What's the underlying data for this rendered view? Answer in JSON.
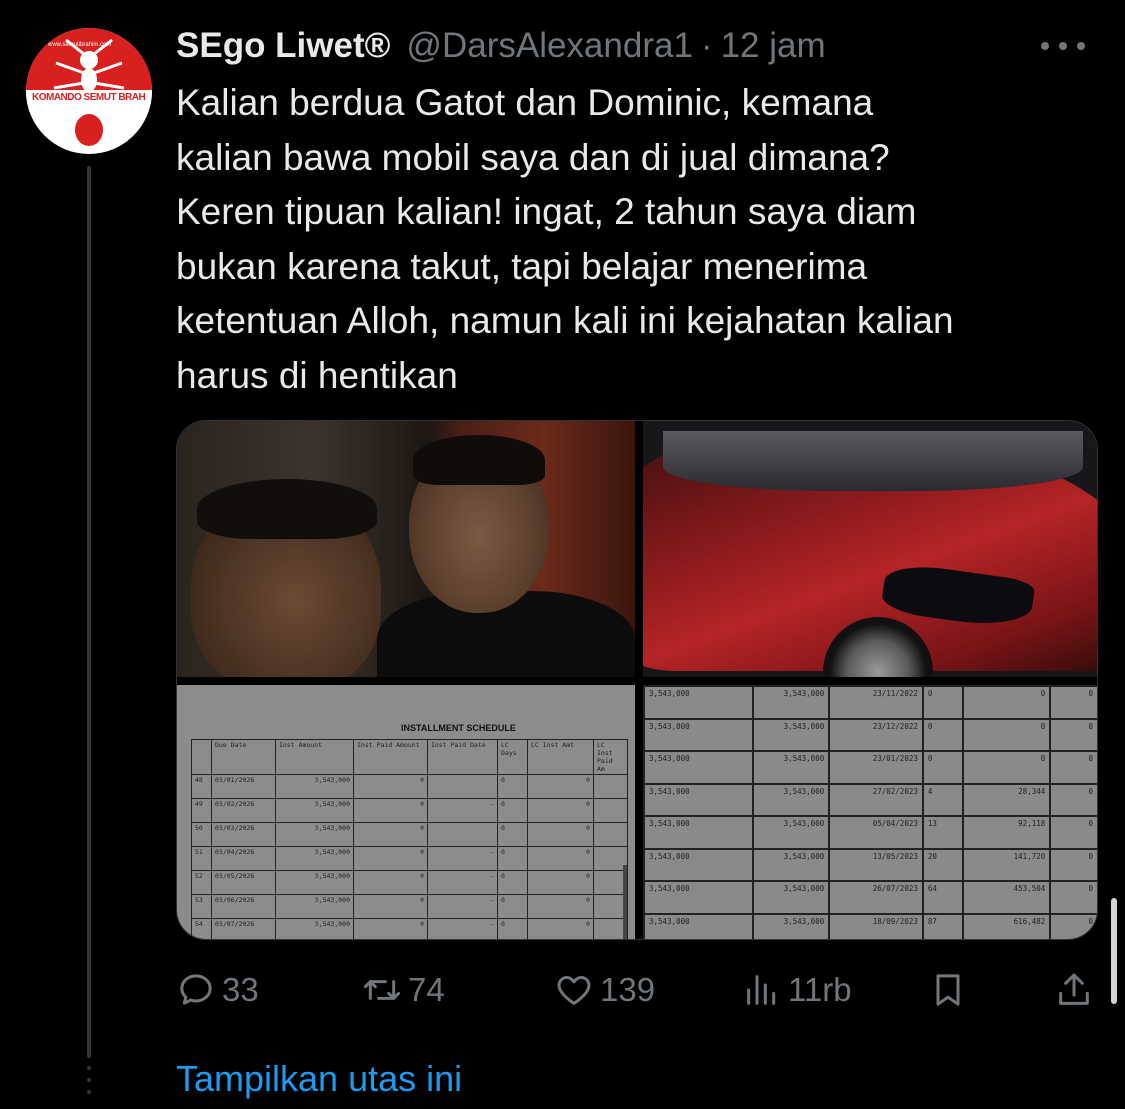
{
  "tweet": {
    "display_name": "SEgo Liwet®",
    "handle": "@DarsAlexandra1",
    "separator": "·",
    "time": "12 jam",
    "text": "Kalian berdua Gatot dan Dominic, kemana\nkalian bawa mobil saya dan di jual dimana?\nKeren tipuan kalian! ingat, 2 tahun saya diam\nbukan karena takut, tapi belajar menerima\nketentuan Alloh, namun kali ini kejahatan kalian\nharus di hentikan"
  },
  "avatar": {
    "logo_text": "KOMANDO SEMUT BRAH",
    "url_text": "www.semutibrahim.com"
  },
  "media": {
    "installment": {
      "title": "INSTALLMENT SCHEDULE",
      "headers": [
        "",
        "Due Date",
        "Inst Amount",
        "Inst Paid Amount",
        "Inst Paid Date",
        "LC Days",
        "LC Inst Amt",
        "LC Inst Paid Am"
      ],
      "rows": [
        [
          "48",
          "03/01/2026",
          "3,543,000",
          "0",
          "",
          "0",
          "0",
          ""
        ],
        [
          "49",
          "03/02/2026",
          "3,543,000",
          "0",
          "-",
          "0",
          "0",
          ""
        ],
        [
          "50",
          "03/03/2026",
          "3,543,000",
          "0",
          "",
          "0",
          "0",
          ""
        ],
        [
          "51",
          "03/04/2026",
          "3,543,000",
          "0",
          "-",
          "0",
          "0",
          ""
        ],
        [
          "52",
          "03/05/2026",
          "3,543,000",
          "0",
          "-",
          "0",
          "0",
          ""
        ],
        [
          "53",
          "03/06/2026",
          "3,543,000",
          "0",
          "-",
          "0",
          "0",
          ""
        ],
        [
          "54",
          "03/07/2026",
          "3,543,000",
          "0",
          "-",
          "0",
          "0",
          ""
        ]
      ]
    },
    "payments": {
      "rows": [
        [
          "3,543,000",
          "3,543,000",
          "23/11/2022",
          "0",
          "0",
          "0"
        ],
        [
          "3,543,000",
          "3,543,000",
          "23/12/2022",
          "0",
          "0",
          "0"
        ],
        [
          "3,543,000",
          "3,543,000",
          "23/01/2023",
          "0",
          "0",
          "0"
        ],
        [
          "3,543,000",
          "3,543,000",
          "27/02/2023",
          "4",
          "28,344",
          "0"
        ],
        [
          "3,543,000",
          "3,543,000",
          "05/04/2023",
          "13",
          "92,118",
          "0"
        ],
        [
          "3,543,000",
          "3,543,000",
          "13/05/2023",
          "20",
          "141,720",
          "0"
        ],
        [
          "3,543,000",
          "3,543,000",
          "26/07/2023",
          "64",
          "453,504",
          "0"
        ],
        [
          "3,543,000",
          "3,543,000",
          "18/09/2023",
          "87",
          "616,482",
          "0"
        ]
      ]
    }
  },
  "actions": {
    "replies": "33",
    "retweets": "74",
    "likes": "139",
    "views": "11rb"
  },
  "show_thread": "Tampilkan utas ini",
  "colors": {
    "background": "#000000",
    "text": "#e7e9ea",
    "muted": "#71767b",
    "link": "#1d9bf0",
    "avatar_red": "#d8201f"
  },
  "icons": [
    "more-icon",
    "reply-icon",
    "retweet-icon",
    "like-icon",
    "views-icon",
    "bookmark-icon",
    "share-icon"
  ]
}
